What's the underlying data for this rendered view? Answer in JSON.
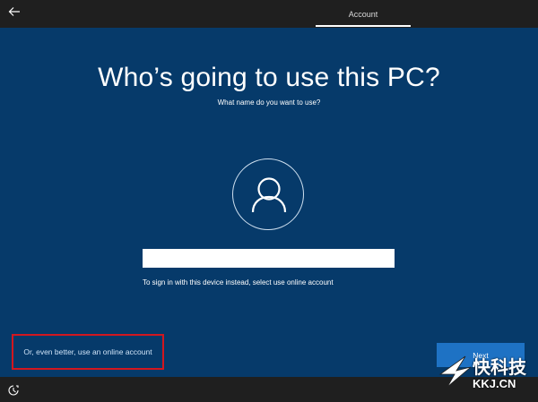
{
  "topbar": {
    "back_icon": "arrow-left-icon",
    "tab_label": "Account"
  },
  "main": {
    "title": "Who’s going to use this PC?",
    "subtitle": "What name do you want to use?",
    "avatar_icon": "user-icon",
    "name_input": {
      "value": "",
      "placeholder": ""
    },
    "hint": "To sign in with this device instead, select use online account",
    "online_account_link": "Or, even better, use an online account",
    "next_label": "Next"
  },
  "bottombar": {
    "ease_of_access_icon": "ease-of-access-icon"
  },
  "watermark": {
    "title": "快科技",
    "subtitle": "KKJ.CN"
  },
  "colors": {
    "panel_bg": "#063a6a",
    "chrome_bg": "#1f1f1f",
    "next_button": "#1e72c4",
    "highlight_box": "#d2171f"
  }
}
